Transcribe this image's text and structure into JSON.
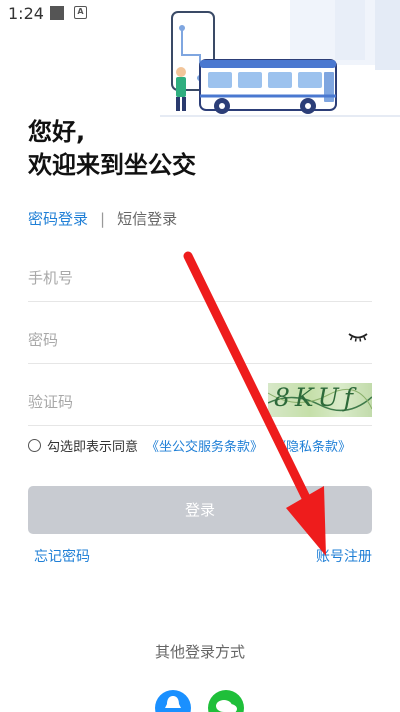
{
  "status_bar": {
    "time": "1:24"
  },
  "greeting": {
    "line1": "您好,",
    "line2": "欢迎来到坐公交"
  },
  "tabs": {
    "password_login": "密码登录",
    "divider": "|",
    "sms_login": "短信登录"
  },
  "form": {
    "phone_placeholder": "手机号",
    "password_placeholder": "密码",
    "captcha_placeholder": "验证码",
    "captcha_code": "8KUf"
  },
  "agreement": {
    "text": "勾选即表示同意",
    "terms": "《坐公交服务条款》",
    "privacy": "《隐私条款》"
  },
  "login_button": "登录",
  "links": {
    "forgot_password": "忘记密码",
    "register": "账号注册"
  },
  "other_login": {
    "title": "其他登录方式"
  },
  "colors": {
    "accent": "#1f7fd6",
    "button_disabled": "#c8cbd1",
    "annotation_red": "#ee1c1c"
  }
}
